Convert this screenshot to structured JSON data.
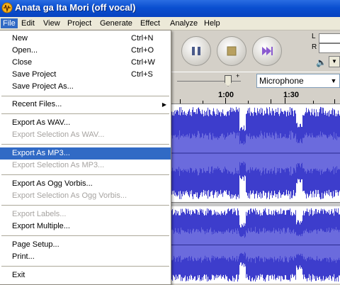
{
  "window": {
    "title": "Anata ga Ita Mori (off vocal)",
    "app_icon": "audio-waveform-icon"
  },
  "menubar": {
    "items": [
      "File",
      "Edit",
      "View",
      "Project",
      "Generate",
      "Effect",
      "Analyze",
      "Help"
    ],
    "active": "File"
  },
  "toolbar": {
    "buttons": [
      {
        "name": "pause-button",
        "icon": "pause-icon"
      },
      {
        "name": "stop-button",
        "icon": "stop-icon"
      },
      {
        "name": "skip-end-button",
        "icon": "skip-end-icon"
      }
    ],
    "meter": {
      "left": "L",
      "right": "R"
    },
    "input_gain_plus": "+",
    "input_source": "Microphone"
  },
  "ruler": {
    "labels": [
      "1:00",
      "1:30"
    ]
  },
  "file_menu": {
    "items": [
      {
        "label": "New",
        "shortcut": "Ctrl+N",
        "enabled": true
      },
      {
        "label": "Open...",
        "shortcut": "Ctrl+O",
        "enabled": true
      },
      {
        "label": "Close",
        "shortcut": "Ctrl+W",
        "enabled": true
      },
      {
        "label": "Save Project",
        "shortcut": "Ctrl+S",
        "enabled": true
      },
      {
        "label": "Save Project As...",
        "shortcut": "",
        "enabled": true
      },
      {
        "label": "Recent Files...",
        "shortcut": "",
        "enabled": true,
        "submenu": true
      },
      {
        "label": "Export As WAV...",
        "shortcut": "",
        "enabled": true
      },
      {
        "label": "Export Selection As WAV...",
        "shortcut": "",
        "enabled": false
      },
      {
        "label": "Export As MP3...",
        "shortcut": "",
        "enabled": true,
        "highlighted": true
      },
      {
        "label": "Export Selection As MP3...",
        "shortcut": "",
        "enabled": false
      },
      {
        "label": "Export As Ogg Vorbis...",
        "shortcut": "",
        "enabled": true
      },
      {
        "label": "Export Selection As Ogg Vorbis...",
        "shortcut": "",
        "enabled": false
      },
      {
        "label": "Export Labels...",
        "shortcut": "",
        "enabled": false
      },
      {
        "label": "Export Multiple...",
        "shortcut": "",
        "enabled": true
      },
      {
        "label": "Page Setup...",
        "shortcut": "",
        "enabled": true
      },
      {
        "label": "Print...",
        "shortcut": "",
        "enabled": true
      },
      {
        "label": "Exit",
        "shortcut": "",
        "enabled": true
      }
    ]
  },
  "colors": {
    "waveform": "#3d3dcc",
    "waveform_light": "#6b6bdd",
    "highlight": "#316ac5",
    "titlebar": "#0a4fd0"
  }
}
